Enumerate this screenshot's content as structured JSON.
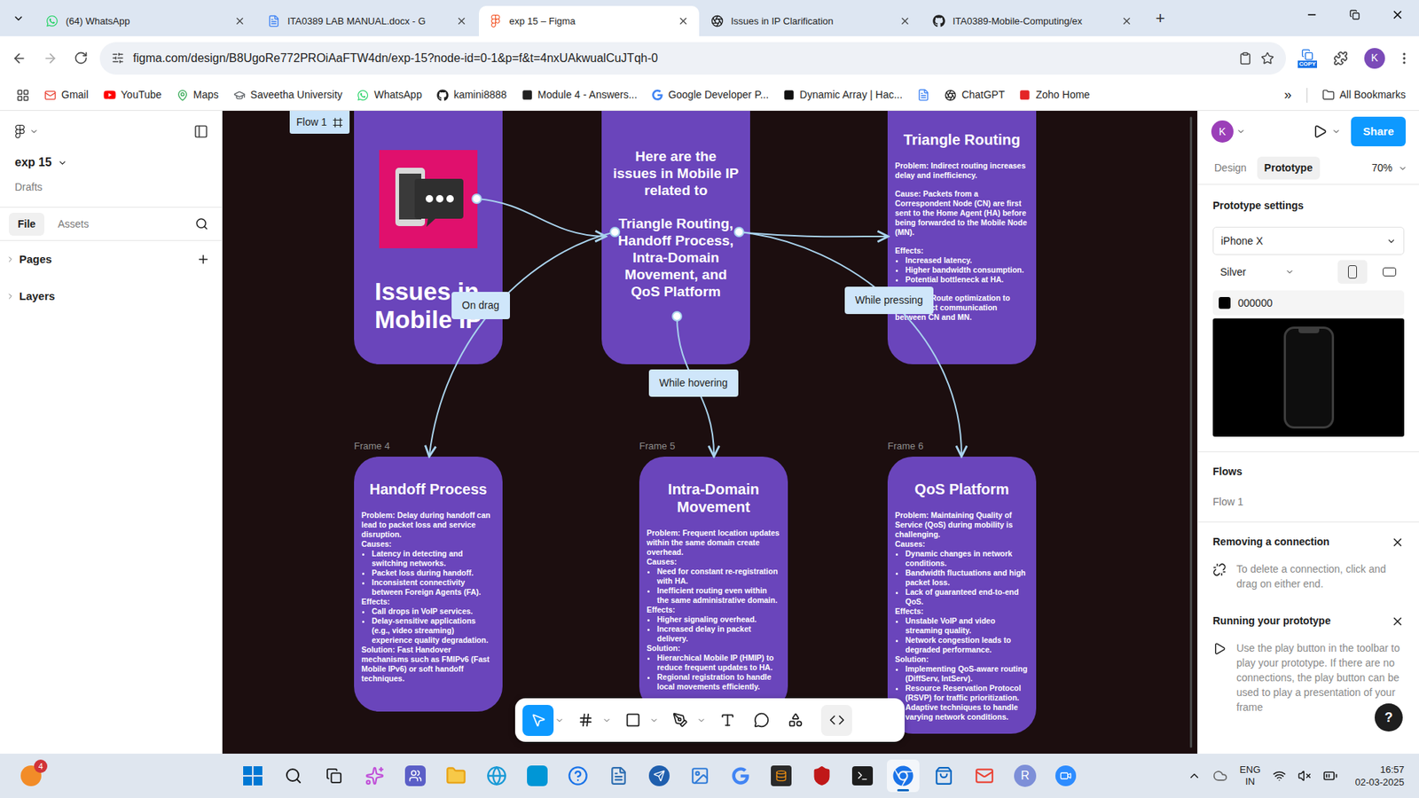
{
  "browser": {
    "tabs": [
      {
        "label": "(64) WhatsApp",
        "selected": false
      },
      {
        "label": "ITA0389 LAB MANUAL.docx - G",
        "selected": false
      },
      {
        "label": "exp 15 – Figma",
        "selected": true
      },
      {
        "label": "Issues in IP Clarification",
        "selected": false
      },
      {
        "label": "ITA0389-Mobile-Computing/ex",
        "selected": false
      }
    ],
    "new_tab": "+",
    "address": "figma.com/design/B8UgoRe772PROiAaFTW4dn/exp-15?node-id=0-1&p=f&t=4nxUAkwualCuJTqh-0",
    "extension_badge": "COPY",
    "profile": "K",
    "bookmarks": [
      {
        "label": "Gmail"
      },
      {
        "label": "YouTube"
      },
      {
        "label": "Maps"
      },
      {
        "label": "Saveetha University"
      },
      {
        "label": "WhatsApp"
      },
      {
        "label": "kamini8888"
      },
      {
        "label": "Module 4 - Answers..."
      },
      {
        "label": "Google Developer P..."
      },
      {
        "label": "Dynamic Array | Hac..."
      },
      {
        "icon_only": true
      },
      {
        "label": "ChatGPT"
      },
      {
        "label": "Zoho Home"
      }
    ],
    "bookmarks_more": "»",
    "all_bookmarks": "All Bookmarks"
  },
  "figma": {
    "file_name": "exp 15",
    "file_location": "Drafts",
    "panel_tabs": [
      {
        "label": "File",
        "selected": true
      },
      {
        "label": "Assets",
        "selected": false
      }
    ],
    "sections": [
      {
        "label": "Pages",
        "expanded": false,
        "addable": true
      },
      {
        "label": "Layers",
        "expanded": false,
        "addable": false
      }
    ],
    "canvas": {
      "flow_label": "Flow 1",
      "frames": [
        {
          "kind": "cover",
          "title": "Issues in Mobile IP"
        },
        {
          "kind": "intro",
          "paragraphs": [
            "Here are the issues in Mobile IP related to",
            "Triangle Routing, Handoff Process, Intra-Domain Movement, and QoS Platform"
          ]
        },
        {
          "kind": "detail",
          "spaced": true,
          "title": "Triangle Routing",
          "sections": [
            {
              "text": "Problem: Indirect routing increases delay and inefficiency.",
              "bullets": []
            },
            {
              "text": "Cause: Packets from a Correspondent Node (CN) are first sent to the Home Agent (HA) before being forwarded to the Mobile Node (MN).",
              "bullets": []
            },
            {
              "text": "Effects:",
              "bullets": [
                "Increased latency.",
                "Higher bandwidth consumption.",
                "Potential bottleneck at HA."
              ]
            },
            {
              "text": "Solution: Route optimization to allow direct communication between CN and MN.",
              "bullets": []
            }
          ]
        },
        {
          "kind": "detail",
          "spaced": false,
          "label": "Frame 4",
          "title": "Handoff Process",
          "sections": [
            {
              "text": "Problem: Delay during handoff can lead to packet loss and service disruption.",
              "bullets": []
            },
            {
              "text": "Causes:",
              "bullets": [
                "Latency in detecting and switching networks.",
                "Packet loss during handoff.",
                "Inconsistent connectivity between Foreign Agents (FA)."
              ]
            },
            {
              "text": "Effects:",
              "bullets": [
                "Call drops in VoIP services.",
                "Delay-sensitive applications (e.g., video streaming) experience quality degradation."
              ]
            },
            {
              "text": "Solution: Fast Handover mechanisms such as FMIPv6 (Fast Mobile IPv6) or soft handoff techniques.",
              "bullets": []
            }
          ]
        },
        {
          "kind": "detail",
          "spaced": false,
          "label": "Frame 5",
          "title": "Intra-Domain Movement",
          "sections": [
            {
              "text": "Problem: Frequent location updates within the same domain create overhead.",
              "bullets": []
            },
            {
              "text": "Causes:",
              "bullets": [
                "Need for constant re-registration with HA.",
                "Inefficient routing even within the same administrative domain."
              ]
            },
            {
              "text": "Effects:",
              "bullets": [
                "Higher signaling overhead.",
                "Increased delay in packet delivery."
              ]
            },
            {
              "text": "Solution:",
              "bullets": [
                "Hierarchical Mobile IP (HMIP) to reduce frequent updates to HA.",
                "Regional registration to handle local movements efficiently."
              ]
            }
          ]
        },
        {
          "kind": "detail",
          "spaced": false,
          "label": "Frame 6",
          "title": "QoS Platform",
          "sections": [
            {
              "text": "Problem: Maintaining Quality of Service (QoS) during mobility is challenging.",
              "bullets": []
            },
            {
              "text": "Causes:",
              "bullets": [
                "Dynamic changes in network conditions.",
                "Bandwidth fluctuations and high packet loss.",
                "Lack of guaranteed end-to-end QoS."
              ]
            },
            {
              "text": "Effects:",
              "bullets": [
                "Unstable VoIP and video streaming quality.",
                "Network congestion leads to degraded performance."
              ]
            },
            {
              "text": "Solution:",
              "bullets": [
                "Implementing QoS-aware routing (DiffServ, IntServ).",
                "Resource Reservation Protocol (RSVP) for traffic prioritization.",
                "Adaptive techniques to handle varying network conditions."
              ]
            }
          ]
        }
      ],
      "connections": [
        {
          "label": "On drag"
        },
        {
          "label": "While pressing"
        },
        {
          "label": "While hovering"
        }
      ]
    },
    "toolbar": [
      {
        "selected": true
      },
      {
        "selected": false
      },
      {
        "selected": false
      },
      {
        "selected": false
      },
      {
        "selected": false
      },
      {
        "selected": false
      },
      {
        "selected": false
      },
      {
        "selected": false
      }
    ],
    "right": {
      "avatar": "K",
      "share": "Share",
      "tabs": [
        {
          "label": "Design",
          "selected": false
        },
        {
          "label": "Prototype",
          "selected": true
        }
      ],
      "zoom": "70%",
      "settings_title": "Prototype settings",
      "device": "iPhone X",
      "device_color": "Silver",
      "orientations": [
        {
          "selected": true
        },
        {
          "selected": false
        }
      ],
      "background": "000000",
      "flows_title": "Flows",
      "flows": [
        "Flow 1"
      ],
      "tips": [
        {
          "title": "Removing a connection",
          "text": "To delete a connection, click and drag on either end."
        },
        {
          "title": "Running your prototype",
          "text": "Use the play button in the toolbar to play your prototype. If there are no connections, the play button can be used to play a presentation of your frame"
        }
      ],
      "help": "?"
    }
  },
  "taskbar": {
    "badge": "4",
    "app_letter": "R",
    "language": "ENG",
    "region": "IN",
    "time": "16:57",
    "date": "02-03-2025"
  }
}
